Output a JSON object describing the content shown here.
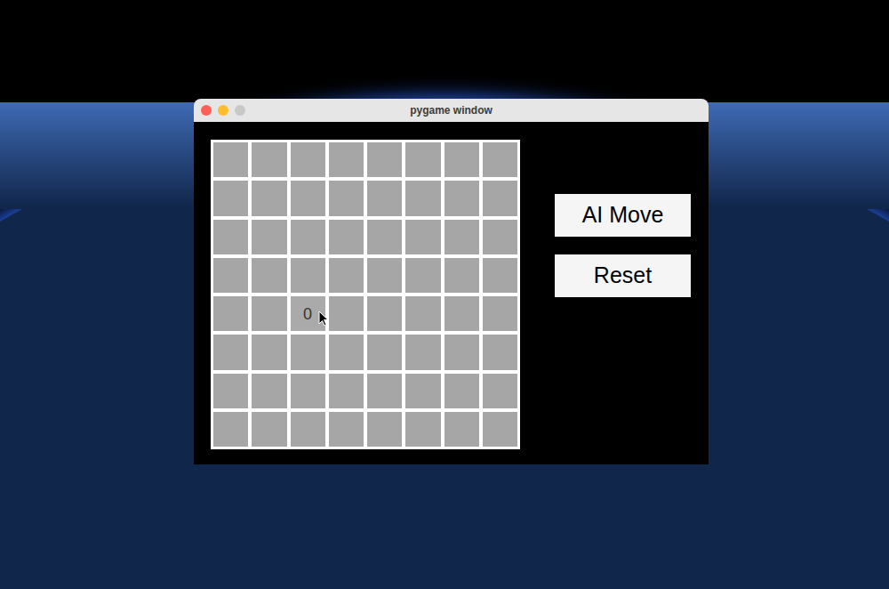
{
  "window": {
    "title": "pygame window"
  },
  "board": {
    "rows": [
      [
        {
          "revealed": false
        },
        {
          "revealed": false
        },
        {
          "revealed": false
        },
        {
          "revealed": false
        },
        {
          "revealed": false
        },
        {
          "revealed": false
        },
        {
          "revealed": false
        },
        {
          "revealed": false
        }
      ],
      [
        {
          "revealed": false
        },
        {
          "revealed": false
        },
        {
          "revealed": false
        },
        {
          "revealed": false
        },
        {
          "revealed": false
        },
        {
          "revealed": false
        },
        {
          "revealed": false
        },
        {
          "revealed": false
        }
      ],
      [
        {
          "revealed": false
        },
        {
          "revealed": false
        },
        {
          "revealed": false
        },
        {
          "revealed": false
        },
        {
          "revealed": false
        },
        {
          "revealed": false
        },
        {
          "revealed": false
        },
        {
          "revealed": false
        }
      ],
      [
        {
          "revealed": false
        },
        {
          "revealed": false
        },
        {
          "revealed": false
        },
        {
          "revealed": false
        },
        {
          "revealed": false
        },
        {
          "revealed": false
        },
        {
          "revealed": false
        },
        {
          "revealed": false
        }
      ],
      [
        {
          "revealed": false
        },
        {
          "revealed": false
        },
        {
          "revealed": true,
          "text": "0"
        },
        {
          "revealed": false
        },
        {
          "revealed": false
        },
        {
          "revealed": false
        },
        {
          "revealed": false
        },
        {
          "revealed": false
        }
      ],
      [
        {
          "revealed": false
        },
        {
          "revealed": false
        },
        {
          "revealed": false
        },
        {
          "revealed": false
        },
        {
          "revealed": false
        },
        {
          "revealed": false
        },
        {
          "revealed": false
        },
        {
          "revealed": false
        }
      ],
      [
        {
          "revealed": false
        },
        {
          "revealed": false
        },
        {
          "revealed": false
        },
        {
          "revealed": false
        },
        {
          "revealed": false
        },
        {
          "revealed": false
        },
        {
          "revealed": false
        },
        {
          "revealed": false
        }
      ],
      [
        {
          "revealed": false
        },
        {
          "revealed": false
        },
        {
          "revealed": false
        },
        {
          "revealed": false
        },
        {
          "revealed": false
        },
        {
          "revealed": false
        },
        {
          "revealed": false
        },
        {
          "revealed": false
        }
      ]
    ]
  },
  "buttons": [
    "AI Move",
    "Reset"
  ]
}
